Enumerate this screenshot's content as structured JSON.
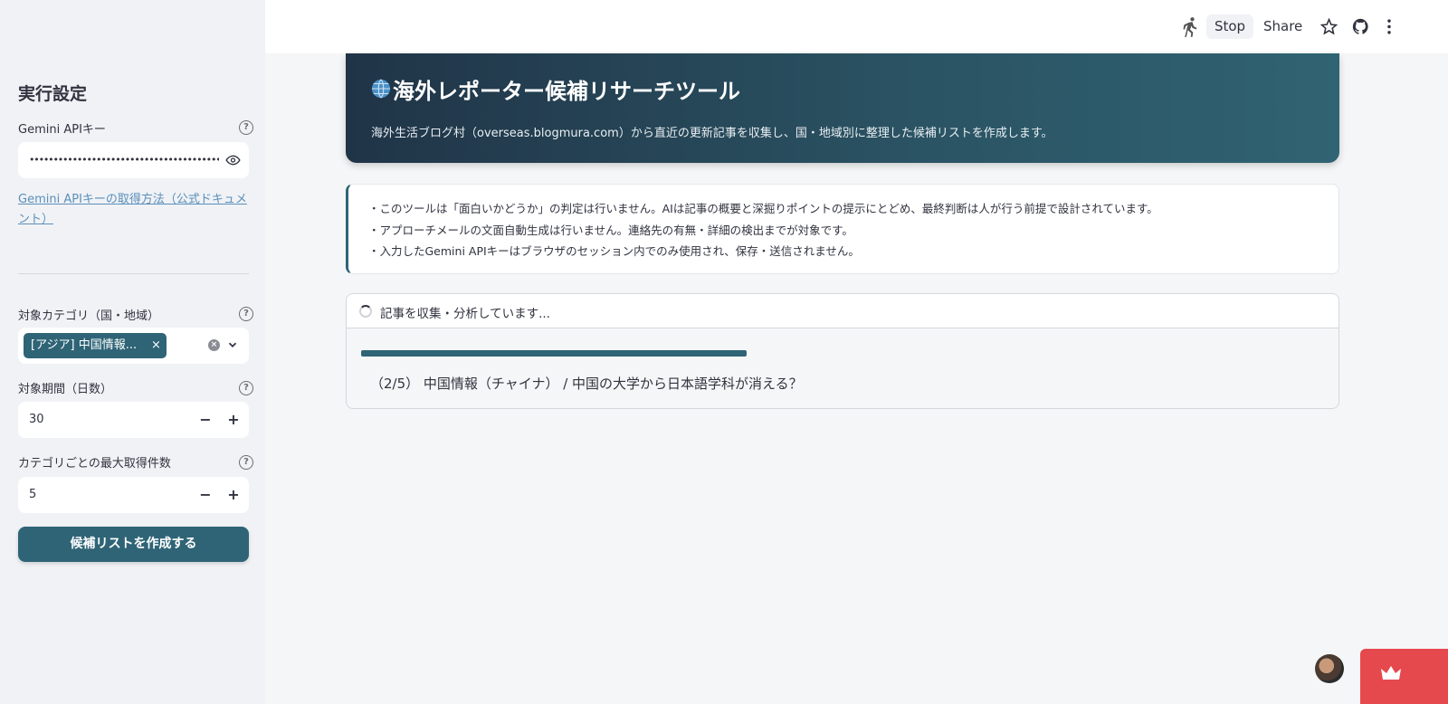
{
  "header": {
    "stop_label": "Stop",
    "share_label": "Share"
  },
  "sidebar": {
    "title": "実行設定",
    "api_key": {
      "label": "Gemini APIキー",
      "value": "••••••••••••••••••••••••••••••••••••••••••••••••••"
    },
    "doc_link": "Gemini APIキーの取得方法（公式ドキュメント）",
    "category": {
      "label": "対象カテゴリ（国・地域）",
      "chip": "[アジア] 中国情報...",
      "chip_remove": "×"
    },
    "period": {
      "label": "対象期間（日数）",
      "value": "30"
    },
    "max_items": {
      "label": "カテゴリごとの最大取得件数",
      "value": "5"
    },
    "stepper_minus": "−",
    "stepper_plus": "+",
    "help_glyph": "?",
    "submit_label": "候補リストを作成する"
  },
  "main": {
    "hero": {
      "title": "海外レポーター候補リサーチツール",
      "subtitle": "海外生活ブログ村（overseas.blogmura.com）から直近の更新記事を収集し、国・地域別に整理した候補リストを作成します。"
    },
    "notes": [
      "・このツールは「面白いかどうか」の判定は行いません。AIは記事の概要と深掘りポイントの提示にとどめ、最終判断は人が行う前提で設計されています。",
      "・アプローチメールの文面自動生成は行いません。連絡先の有無・詳細の検出までが対象です。",
      "・入力したGemini APIキーはブラウザのセッション内でのみ使用され、保存・送信されません。"
    ],
    "status": {
      "label": "記事を収集・分析しています...",
      "progress": 0.4,
      "progress_text": "（2/5） 中国情報（チャイナ） / 中国の大学から日本語学科が消える？"
    }
  },
  "colors": {
    "accent": "#2e6476",
    "badge": "#e5484d"
  }
}
